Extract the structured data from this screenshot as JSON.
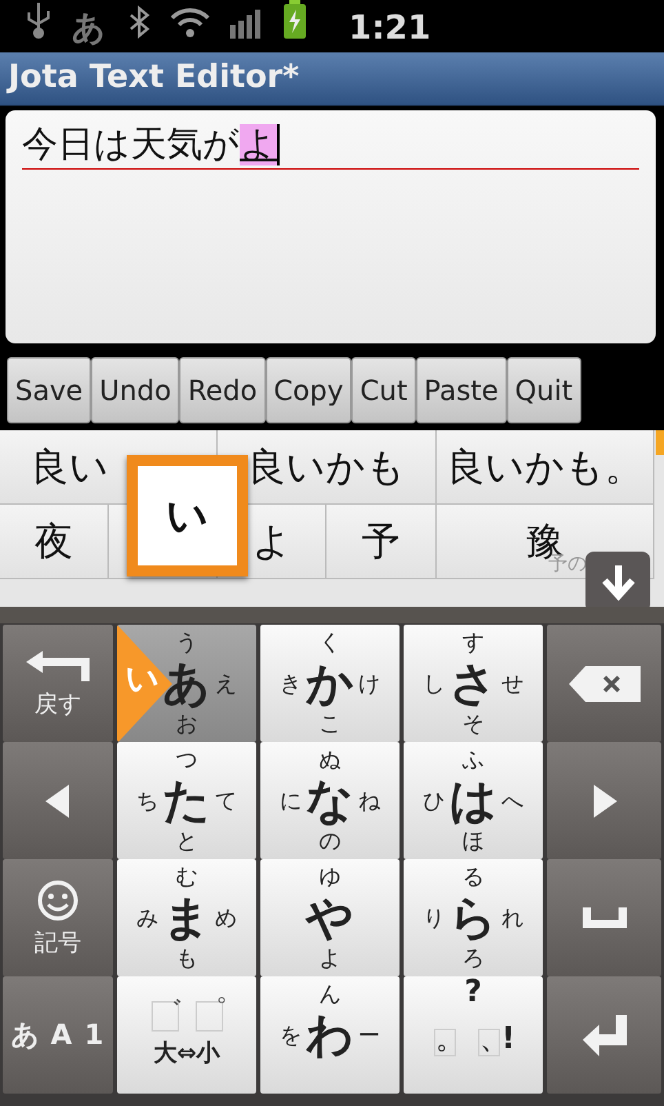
{
  "status_bar": {
    "ime": "あ",
    "time": "1:21"
  },
  "window": {
    "title": "Jota Text Editor*"
  },
  "editor": {
    "text": "今日は天気が",
    "composing": "よ"
  },
  "buttons": [
    "Save",
    "Undo",
    "Redo",
    "Copy",
    "Cut",
    "Paste",
    "Quit"
  ],
  "candidates": {
    "lines": [
      {
        "words": [
          {
            "text": "良い"
          },
          {
            "text": "良いかも"
          },
          {
            "text": "良いかも。"
          }
        ]
      },
      {
        "words": [
          {
            "text": "夜"
          },
          {
            "covered": true
          },
          {
            "text": "よ"
          },
          {
            "text": "予"
          },
          {
            "text": "豫",
            "note": "予の"
          }
        ]
      }
    ],
    "preview": "い"
  },
  "keyboard": {
    "rows": [
      [
        {
          "kind": "back",
          "label": "戻す"
        },
        {
          "kind": "kana",
          "main": "あ",
          "up": "う",
          "left": "い",
          "right": "え",
          "down": "お",
          "pressed": true
        },
        {
          "kind": "kana",
          "main": "か",
          "up": "く",
          "left": "き",
          "right": "け",
          "down": "こ",
          "pressed": false
        },
        {
          "kind": "kana",
          "main": "さ",
          "up": "す",
          "left": "し",
          "right": "せ",
          "down": "そ",
          "pressed": false
        },
        {
          "kind": "backspace"
        }
      ],
      [
        {
          "kind": "left"
        },
        {
          "kind": "kana",
          "main": "た",
          "up": "つ",
          "left": "ち",
          "right": "て",
          "down": "と",
          "pressed": false
        },
        {
          "kind": "kana",
          "main": "な",
          "up": "ぬ",
          "left": "に",
          "right": "ね",
          "down": "の",
          "pressed": false
        },
        {
          "kind": "kana",
          "main": "は",
          "up": "ふ",
          "left": "ひ",
          "right": "へ",
          "down": "ほ",
          "pressed": false
        },
        {
          "kind": "right"
        }
      ],
      [
        {
          "kind": "symbol",
          "label": "記号"
        },
        {
          "kind": "kana",
          "main": "ま",
          "up": "む",
          "left": "み",
          "right": "め",
          "down": "も",
          "pressed": false
        },
        {
          "kind": "kana",
          "main": "や",
          "up": "ゆ",
          "down": "よ",
          "pressed": false
        },
        {
          "kind": "kana",
          "main": "ら",
          "up": "る",
          "left": "り",
          "right": "れ",
          "down": "ろ",
          "pressed": false
        },
        {
          "kind": "space"
        }
      ],
      [
        {
          "kind": "mode",
          "label": "あ A 1"
        },
        {
          "kind": "dakuten",
          "marks": [
            "゛",
            "゜"
          ],
          "main": "大⇔小"
        },
        {
          "kind": "kana",
          "main": "わ",
          "up": "ん",
          "left": "を",
          "right": "ー",
          "pressed": false
        },
        {
          "kind": "punct",
          "up": "?",
          "marks": [
            "。",
            "、"
          ],
          "right": "!"
        },
        {
          "kind": "enter"
        }
      ]
    ]
  }
}
